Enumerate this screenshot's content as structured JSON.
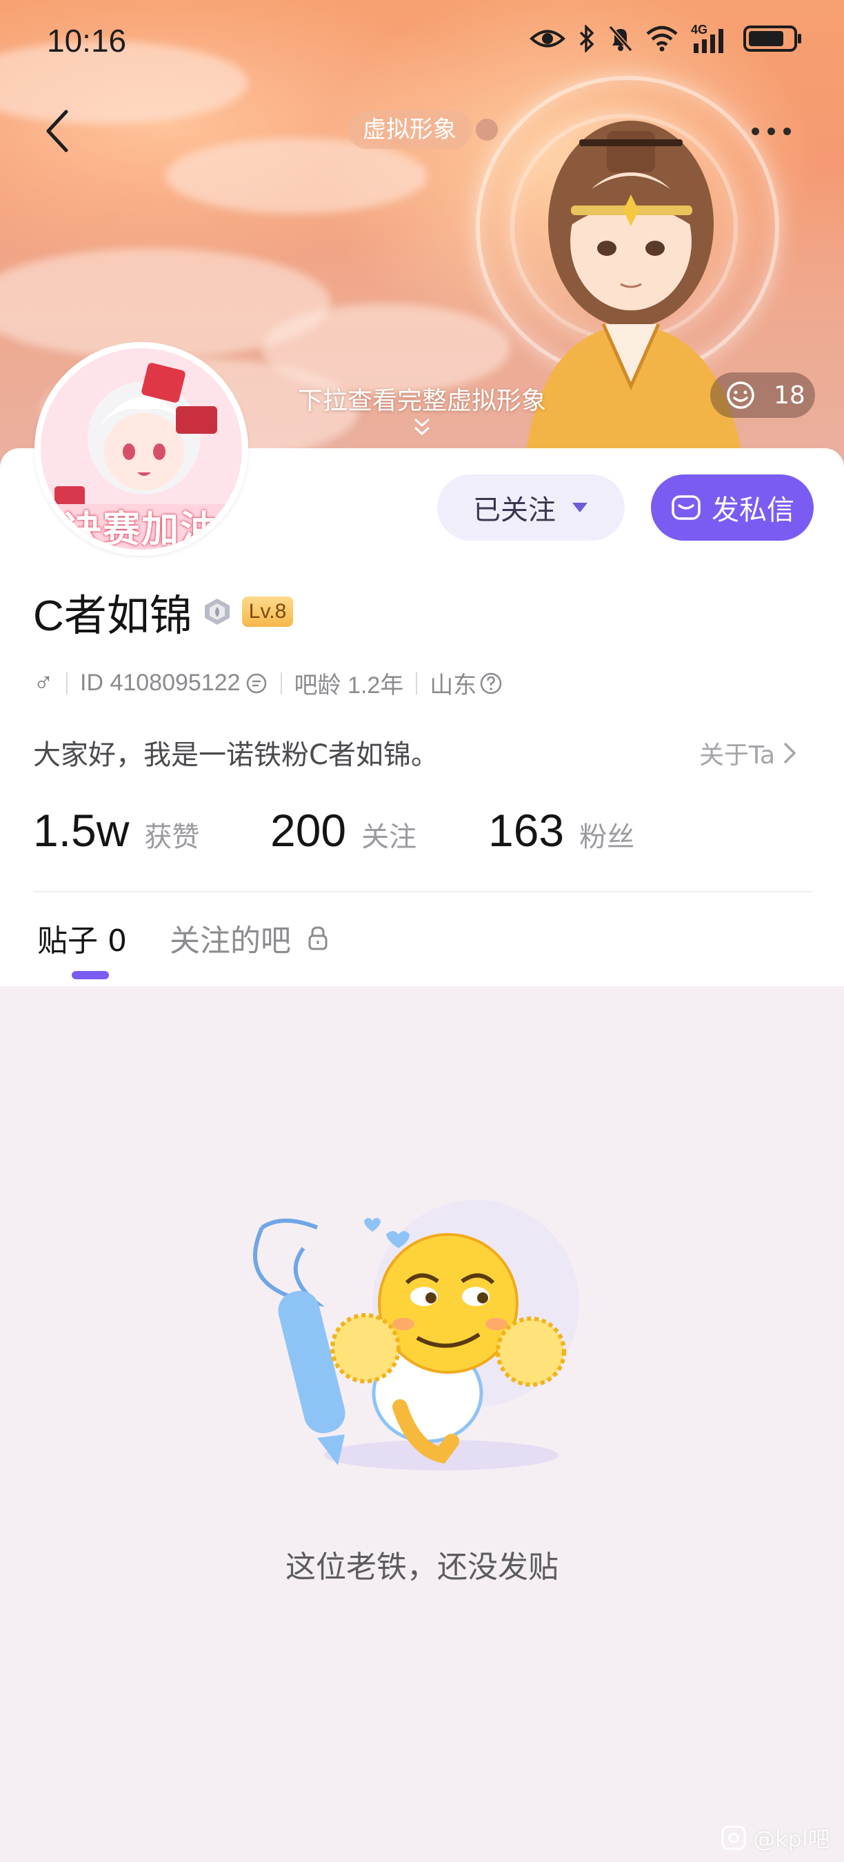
{
  "status_bar": {
    "time": "10:16",
    "network_label": "4G",
    "battery": 0.8
  },
  "header": {
    "avatar_tag": "虚拟形象",
    "pull_hint": "下拉查看完整虚拟形象",
    "like_count": "18",
    "icons": [
      "back-arrow-icon",
      "more-dots-icon",
      "smile-icon",
      "chevron-down-icon"
    ]
  },
  "profile": {
    "avatar_caption": "决赛加油",
    "follow_label": "已关注",
    "dm_label": "发私信",
    "username": "C者如锦",
    "level": "Lv.8",
    "gender_symbol": "♂",
    "id_text": "ID 4108095122",
    "bar_age": "吧龄 1.2年",
    "location": "山东",
    "bio": "大家好，我是一诺铁粉C者如锦。",
    "about_link": "关于Ta"
  },
  "stats": [
    {
      "value": "1.5w",
      "label": "获赞"
    },
    {
      "value": "200",
      "label": "关注"
    },
    {
      "value": "163",
      "label": "粉丝"
    }
  ],
  "tabs": {
    "posts": "贴子 0",
    "followed_bars": "关注的吧"
  },
  "empty_state": {
    "message": "这位老铁，还没发贴"
  },
  "watermark": "@kpl吧",
  "colors": {
    "accent": "#7b5cf2",
    "follow_bg": "#f1eefb",
    "page_bg": "#f5eff3",
    "level_badge": "#f6b84c"
  }
}
